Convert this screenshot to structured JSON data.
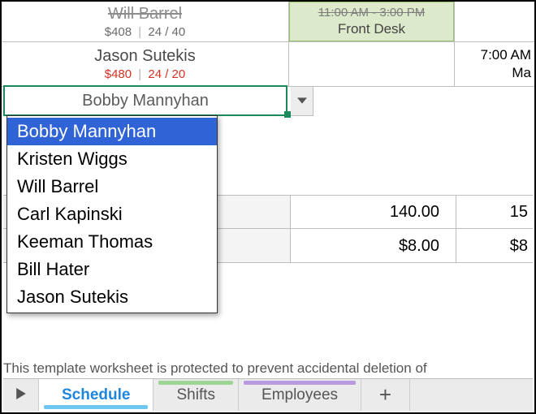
{
  "rows": {
    "r0": {
      "name": "Will Barrel",
      "cost": "$408",
      "ratio": "24 / 40",
      "shift_time": "11:00 AM - 3:00 PM",
      "shift_label": "Front Desk"
    },
    "r1": {
      "name": "Jason Sutekis",
      "cost": "$480",
      "ratio": "24 / 20",
      "right_time": "7:00 AM",
      "right_sub": "Ma"
    }
  },
  "editing": {
    "value": "Bobby Mannyhan"
  },
  "dropdown": {
    "items": [
      "Bobby Mannyhan",
      "Kristen Wiggs",
      "Will Barrel",
      "Carl Kapinski",
      "Keeman Thomas",
      "Bill Hater",
      "Jason Sutekis"
    ],
    "selected_index": 0
  },
  "totals": {
    "r_a": {
      "colB": "140.00",
      "colC": "15"
    },
    "r_b": {
      "colB": "$8.00",
      "colC": "$8"
    }
  },
  "footer_message": "This template worksheet is protected to prevent accidental deletion of",
  "tabs": {
    "items": [
      "Schedule",
      "Shifts",
      "Employees"
    ],
    "active_index": 0,
    "add_label": "+"
  }
}
